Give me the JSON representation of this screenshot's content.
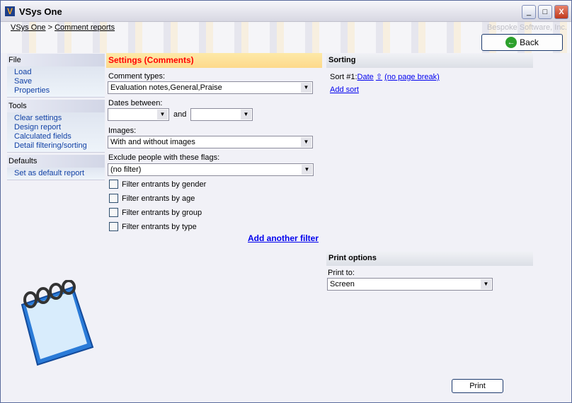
{
  "window": {
    "title": "VSys One",
    "minimize": "_",
    "maximize": "□",
    "close": "X"
  },
  "breadcrumb": [
    "VSys One",
    "Comment reports"
  ],
  "breadcrumb_sep": ">",
  "brand": "Bespoke Software, Inc.",
  "back_label": "Back",
  "sidebar": {
    "groups": [
      {
        "title": "File",
        "items": [
          "Load",
          "Save",
          "Properties"
        ]
      },
      {
        "title": "Tools",
        "items": [
          "Clear settings",
          "Design report",
          "Calculated fields",
          "Detail filtering/sorting"
        ]
      },
      {
        "title": "Defaults",
        "items": [
          "Set as default report"
        ]
      }
    ]
  },
  "settings": {
    "title": "Settings (Comments)",
    "comment_types_label": "Comment types:",
    "comment_types_value": "Evaluation notes,General,Praise",
    "dates_label": "Dates between:",
    "dates_and": "and",
    "date_from": "",
    "date_to": "",
    "images_label": "Images:",
    "images_value": "With and without images",
    "flags_label": "Exclude people with these flags:",
    "flags_value": "(no filter)",
    "filters": [
      "Filter entrants by gender",
      "Filter entrants by age",
      "Filter entrants by group",
      "Filter entrants by type"
    ],
    "add_filter": "Add another filter"
  },
  "sorting": {
    "title": "Sorting",
    "sort_label": "Sort #1:",
    "sort_field": "Date",
    "sort_dir": "⇧",
    "page_break": "(no page break)",
    "add_sort": "Add sort"
  },
  "print_options": {
    "title": "Print options",
    "print_to_label": "Print to:",
    "print_to_value": "Screen"
  },
  "print_label": "Print",
  "colors": {
    "settings_title": "#ff0000",
    "link": "#0000ee",
    "sidebar_link": "#1242a6"
  }
}
